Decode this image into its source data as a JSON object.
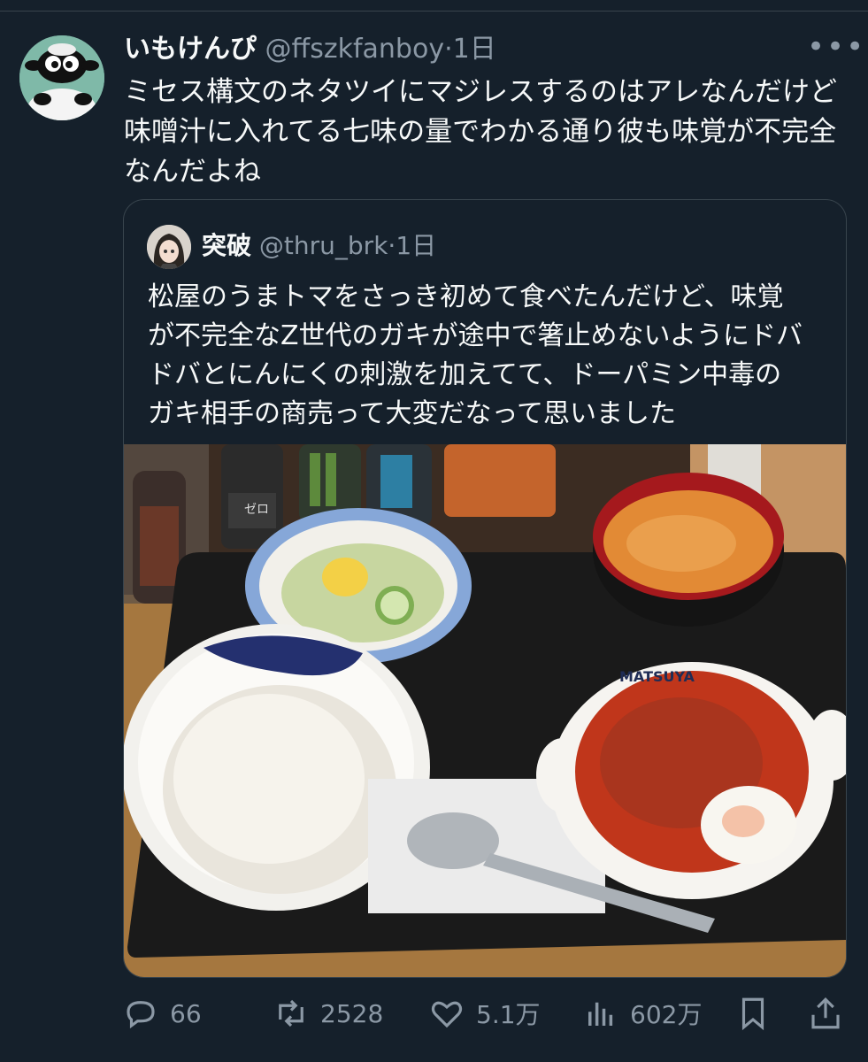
{
  "tweet": {
    "display_name": "いもけんぴ",
    "handle": "@ffszkfanboy",
    "separator": "·",
    "time": "1日",
    "text": "ミセス構文のネタツイにマジレスするのはアレなんだけど\n味噌汁に入れてる七味の量でわかる通り彼も味覚が不完全\nなんだよね",
    "more_label": "•••"
  },
  "quote": {
    "display_name": "突破",
    "handle": "@thru_brk",
    "separator": "·",
    "time": "1日",
    "text": "松屋のうまトマをさっき初めて食べたんだけど、味覚\nが不完全なZ世代のガキが途中で箸止めないようにドバ\nドバとにんにくの刺激を加えてて、ドーパミン中毒の\nガキ相手の商売って大変だなって思いました",
    "photo_bowl_text": "MATSUYA",
    "photo_bottle_text": "ゼロ"
  },
  "actions": {
    "replies": "66",
    "retweets": "2528",
    "likes": "5.1万",
    "views": "602万"
  },
  "icons": [
    "reply-icon",
    "retweet-icon",
    "like-icon",
    "views-icon",
    "bookmark-icon",
    "share-icon",
    "more-icon"
  ],
  "colors": {
    "background": "#15202b",
    "secondary_text": "#8b98a5",
    "border": "#38444d"
  }
}
